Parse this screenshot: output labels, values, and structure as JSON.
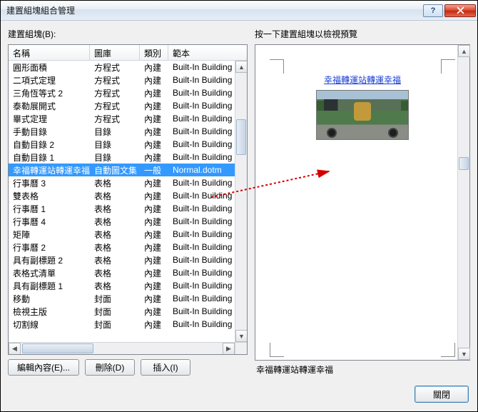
{
  "window": {
    "title": "建置組塊組合管理"
  },
  "labels": {
    "left": "建置組塊(B):",
    "right": "按一下建置組塊以檢視預覽"
  },
  "columns": {
    "name": "名稱",
    "gallery": "圖庫",
    "category": "類別",
    "template": "範本"
  },
  "rows": [
    {
      "name": "圓形面積",
      "gallery": "方程式",
      "category": "內建",
      "template": "Built-In Building",
      "selected": false
    },
    {
      "name": "二項式定理",
      "gallery": "方程式",
      "category": "內建",
      "template": "Built-In Building",
      "selected": false
    },
    {
      "name": "三角恆等式 2",
      "gallery": "方程式",
      "category": "內建",
      "template": "Built-In Building",
      "selected": false
    },
    {
      "name": "泰勒展開式",
      "gallery": "方程式",
      "category": "內建",
      "template": "Built-In Building",
      "selected": false
    },
    {
      "name": "畢式定理",
      "gallery": "方程式",
      "category": "內建",
      "template": "Built-In Building",
      "selected": false
    },
    {
      "name": "手動目錄",
      "gallery": "目錄",
      "category": "內建",
      "template": "Built-In Building",
      "selected": false
    },
    {
      "name": "自動目錄 2",
      "gallery": "目錄",
      "category": "內建",
      "template": "Built-In Building",
      "selected": false
    },
    {
      "name": "自動目錄 1",
      "gallery": "目錄",
      "category": "內建",
      "template": "Built-In Building",
      "selected": false
    },
    {
      "name": "幸福轉運站轉運幸福",
      "gallery": "自動圖文集",
      "category": "一般",
      "template": "Normal.dotm",
      "selected": true
    },
    {
      "name": "行事曆 3",
      "gallery": "表格",
      "category": "內建",
      "template": "Built-In Building",
      "selected": false
    },
    {
      "name": "雙表格",
      "gallery": "表格",
      "category": "內建",
      "template": "Built-In Building",
      "selected": false
    },
    {
      "name": "行事曆 1",
      "gallery": "表格",
      "category": "內建",
      "template": "Built-In Building",
      "selected": false
    },
    {
      "name": "行事曆 4",
      "gallery": "表格",
      "category": "內建",
      "template": "Built-In Building",
      "selected": false
    },
    {
      "name": "矩陣",
      "gallery": "表格",
      "category": "內建",
      "template": "Built-In Building",
      "selected": false
    },
    {
      "name": "行事曆 2",
      "gallery": "表格",
      "category": "內建",
      "template": "Built-In Building",
      "selected": false
    },
    {
      "name": "具有副標題 2",
      "gallery": "表格",
      "category": "內建",
      "template": "Built-In Building",
      "selected": false
    },
    {
      "name": "表格式清單",
      "gallery": "表格",
      "category": "內建",
      "template": "Built-In Building",
      "selected": false
    },
    {
      "name": "具有副標題 1",
      "gallery": "表格",
      "category": "內建",
      "template": "Built-In Building",
      "selected": false
    },
    {
      "name": "移動",
      "gallery": "封面",
      "category": "內建",
      "template": "Built-In Building",
      "selected": false
    },
    {
      "name": "檢視主版",
      "gallery": "封面",
      "category": "內建",
      "template": "Built-In Building",
      "selected": false
    },
    {
      "name": "切割線",
      "gallery": "封面",
      "category": "內建",
      "template": "Built-In Building",
      "selected": false
    }
  ],
  "preview": {
    "caption": "幸福轉運站轉運幸福",
    "name": "幸福轉運站轉運幸福"
  },
  "buttons": {
    "edit": "編輯內容(E)...",
    "delete": "刪除(D)",
    "insert": "插入(I)",
    "close": "關閉"
  }
}
